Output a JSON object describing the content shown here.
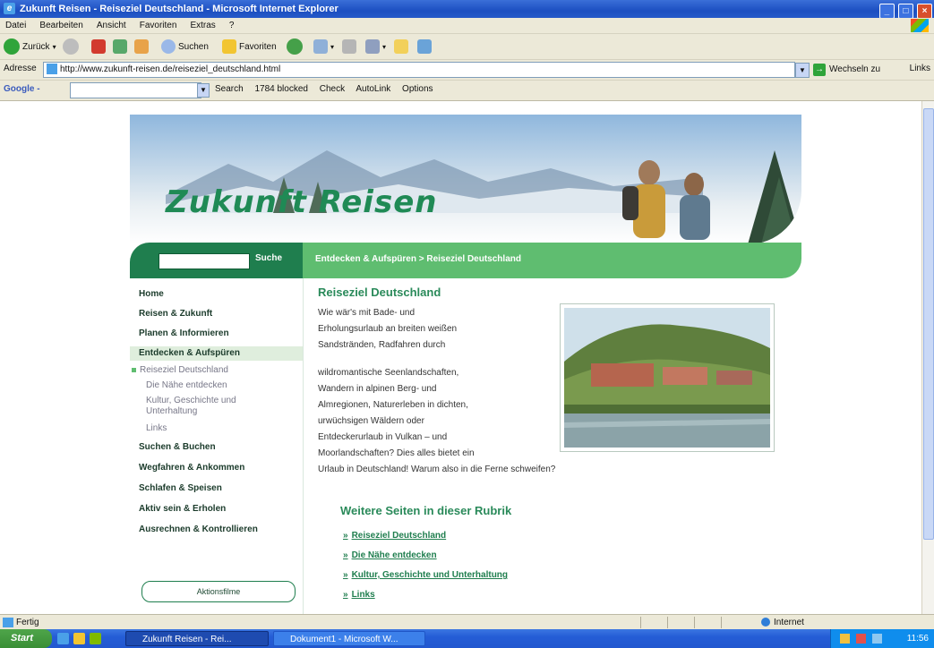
{
  "window": {
    "title": "Zukunft Reisen - Reiseziel Deutschland - Microsoft Internet Explorer",
    "controls": [
      "_",
      "□",
      "×"
    ]
  },
  "menu": [
    "Datei",
    "Bearbeiten",
    "Ansicht",
    "Favoriten",
    "Extras",
    "?"
  ],
  "toolbar": {
    "back": "Zurück",
    "search": "Suchen",
    "favorites": "Favoriten"
  },
  "address": {
    "label": "Adresse",
    "url": "http://www.zukunft-reisen.de/reiseziel_deutschland.html",
    "go_label": "Wechseln zu",
    "links_label": "Links"
  },
  "google": {
    "logo": "Google -",
    "search": "Search",
    "blocked": "1784 blocked",
    "check": "Check",
    "autolink": "AutoLink",
    "options": "Options"
  },
  "site": {
    "brand": "Zukunft Reisen",
    "search_button": "Suche",
    "breadcrumb": "Entdecken & Aufspüren  >  Reiseziel Deutschland",
    "nav": [
      {
        "label": "Home"
      },
      {
        "label": "Reisen & Zukunft"
      },
      {
        "label": "Planen & Informieren"
      },
      {
        "label": "Entdecken & Aufspüren"
      }
    ],
    "subnav": [
      {
        "label": "Reiseziel Deutschland"
      },
      {
        "label": "Die Nähe entdecken"
      },
      {
        "label": "Kultur, Geschichte und"
      },
      {
        "label": "Unterhaltung"
      },
      {
        "label": "Links"
      }
    ],
    "nav2": [
      {
        "label": "Suchen & Buchen"
      },
      {
        "label": "Wegfahren & Ankommen"
      },
      {
        "label": "Schlafen & Speisen"
      },
      {
        "label": "Aktiv sein & Erholen"
      },
      {
        "label": "Ausrechnen & Kontrollieren"
      }
    ],
    "side_button": "Aktionsfilme",
    "content_title": "Reiseziel Deutschland",
    "paragraph_lines": [
      "Wie wär's mit Bade- und",
      "Erholungsurlaub an breiten weißen",
      "Sandstränden, Radfahren durch",
      "wildromantische Seenlandschaften,",
      "Wandern in alpinen Berg- und",
      "Almregionen, Naturerleben in dichten,",
      "urwüchsigen Wäldern oder",
      "Entdeckerurlaub in Vulkan – und",
      "Moorlandschaften? Dies alles bietet ein",
      "Urlaub in Deutschland! Warum also in die Ferne schweifen?"
    ],
    "more_title": "Weitere Seiten in dieser Rubrik",
    "more_links": [
      {
        "label": "Reiseziel Deutschland"
      },
      {
        "label": "Die Nähe entdecken"
      },
      {
        "label": "Kultur, Geschichte und Unterhaltung"
      },
      {
        "label": "Links"
      }
    ]
  },
  "status": {
    "text": "Fertig",
    "zone": "Internet"
  },
  "taskbar": {
    "start": "Start",
    "tasks": [
      {
        "label": "Zukunft Reisen - Rei..."
      },
      {
        "label": "Dokument1 - Microsoft W..."
      }
    ],
    "clock": "11:56"
  },
  "colors": {
    "brand_green": "#1f8a55",
    "bar_dark": "#1f7e4e",
    "bar_light": "#5fbd70",
    "xp_blue": "#245dd6"
  }
}
